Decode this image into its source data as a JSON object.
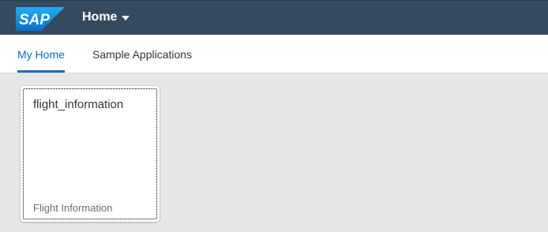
{
  "header": {
    "logo_text": "SAP",
    "menu_label": "Home"
  },
  "tabs": [
    {
      "label": "My Home",
      "active": true
    },
    {
      "label": "Sample Applications",
      "active": false
    }
  ],
  "tiles": [
    {
      "title": "flight_information",
      "subtitle": "Flight Information"
    }
  ],
  "colors": {
    "header_bg": "#354a5f",
    "accent": "#0a6ed1",
    "logo_blue": "#1a8fe0"
  }
}
